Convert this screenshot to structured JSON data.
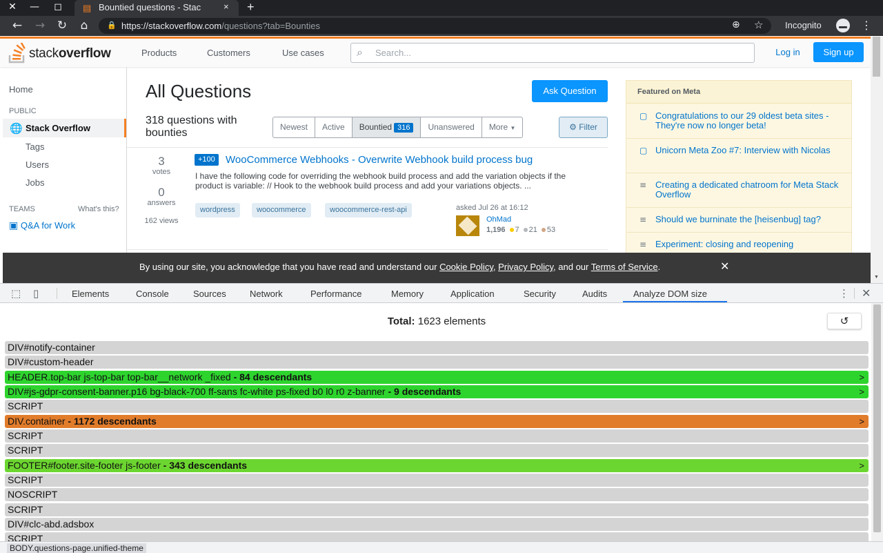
{
  "browser": {
    "tab_title": "Bountied questions - Stac",
    "tab_close": "×",
    "new_tab": "+",
    "url_host": "https://stackoverflow.com",
    "url_path": "/questions?tab=Bounties",
    "incognito_label": "Incognito",
    "win_close": "✕",
    "win_min": "—",
    "win_max": "◻"
  },
  "so": {
    "logo_light": "stack",
    "logo_bold": "overflow",
    "nav": [
      "Products",
      "Customers",
      "Use cases"
    ],
    "search_placeholder": "Search...",
    "login": "Log in",
    "signup": "Sign up"
  },
  "leftnav": {
    "home": "Home",
    "public": "PUBLIC",
    "stack_overflow": "Stack Overflow",
    "tags": "Tags",
    "users": "Users",
    "jobs": "Jobs",
    "teams": "TEAMS",
    "whats_this": "What's this?",
    "qa_for_work": "Q&A for Work"
  },
  "main": {
    "title": "All Questions",
    "ask_button": "Ask Question",
    "count_text": "318 questions with bounties",
    "filters": [
      "Newest",
      "Active",
      "Bountied",
      "Unanswered",
      "More"
    ],
    "bountied_count": "316",
    "filter_button": "Filter"
  },
  "question": {
    "votes": "3",
    "votes_label": "votes",
    "answers": "0",
    "answers_label": "answers",
    "views": "162 views",
    "bounty": "+100",
    "title": "WooCommerce Webhooks - Overwrite Webhook build process bug",
    "excerpt": "I have the following code for overriding the webhook build process and add the variation objects if the product is variable: // Hook to the webhook build process and add your variations objects. ...",
    "tags": [
      "wordpress",
      "woocommerce",
      "woocommerce-rest-api"
    ],
    "asked": "asked Jul 26 at 16:12",
    "user": "OhMad",
    "rep": "1,196",
    "gold": "7",
    "silver": "21",
    "bronze": "53"
  },
  "meta": {
    "header": "Featured on Meta",
    "items": [
      "Congratulations to our 29 oldest beta sites - They're now no longer beta!",
      "Unicorn Meta Zoo #7: Interview with Nicolas",
      "Creating a dedicated chatroom for Meta Stack Overflow",
      "Should we burninate the [heisenbug] tag?",
      "Experiment: closing and reopening"
    ]
  },
  "cookie": {
    "pre": "By using our site, you acknowledge that you have read and understand our ",
    "cookie_policy": "Cookie Policy",
    "sep1": ", ",
    "privacy_policy": "Privacy Policy",
    "sep2": ", and our ",
    "terms": "Terms of Service",
    "end": "."
  },
  "devtools": {
    "tabs": [
      "Elements",
      "Console",
      "Sources",
      "Network",
      "Performance",
      "Memory",
      "Application",
      "Security",
      "Audits",
      "Analyze DOM size"
    ],
    "total_label": "Total:",
    "total_value": "1623 elements",
    "refresh": "↺",
    "breadcrumb": "BODY.questions-page.unified-theme",
    "rows": [
      {
        "name": "DIV#notify-container",
        "desc": "",
        "color": "gray"
      },
      {
        "name": "DIV#custom-header",
        "desc": "",
        "color": "gray"
      },
      {
        "name": "HEADER.top-bar js-top-bar top-bar__network _fixed",
        "desc": " - 84 descendants",
        "color": "green"
      },
      {
        "name": "DIV#js-gdpr-consent-banner.p16 bg-black-700 ff-sans fc-white ps-fixed b0 l0 r0 z-banner",
        "desc": " - 9 descendants",
        "color": "green"
      },
      {
        "name": "SCRIPT",
        "desc": "",
        "color": "gray"
      },
      {
        "name": "DIV.container",
        "desc": " - 1172 descendants",
        "color": "orange"
      },
      {
        "name": "SCRIPT",
        "desc": "",
        "color": "gray"
      },
      {
        "name": "SCRIPT",
        "desc": "",
        "color": "gray"
      },
      {
        "name": "FOOTER#footer.site-footer js-footer",
        "desc": " - 343 descendants",
        "color": "lime"
      },
      {
        "name": "SCRIPT",
        "desc": "",
        "color": "gray"
      },
      {
        "name": "NOSCRIPT",
        "desc": "",
        "color": "gray"
      },
      {
        "name": "SCRIPT",
        "desc": "",
        "color": "gray"
      },
      {
        "name": "DIV#clc-abd.adsbox",
        "desc": "",
        "color": "gray"
      },
      {
        "name": "SCRIPT",
        "desc": "",
        "color": "gray"
      }
    ]
  }
}
